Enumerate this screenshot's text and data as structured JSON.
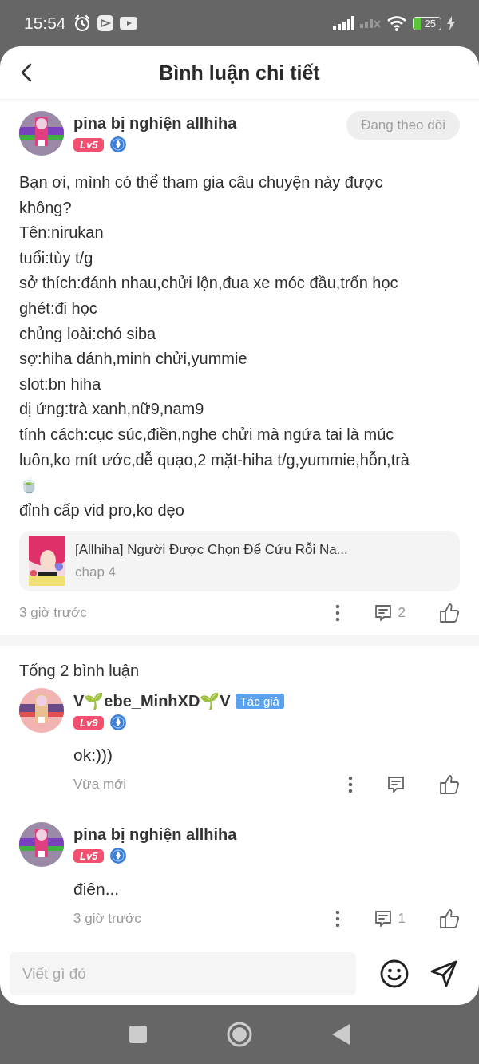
{
  "status_bar": {
    "time": "15:54",
    "battery": "25"
  },
  "header": {
    "title": "Bình luận chi tiết"
  },
  "post": {
    "author": "pina bị nghiện allhiha",
    "level": "Lv5",
    "follow_button": {
      "label": "Đang theo dõi",
      "disabled": true
    },
    "body": "Bạn ơi, mình có thể tham gia câu chuyện này được không?\nTên:nirukan\ntuổi:tùy t/g\nsở thích:đánh nhau,chửi lộn,đua xe móc đầu,trốn học\nghét:đi học\nchủng loài:chó siba\nsợ:hiha đánh,minh chửi,yummie\nslot:bn hiha\ndị ứng:trà xanh,nữ9,nam9\ntính cách:cục súc,điền,nghe chửi mà ngứa tai là múc luôn,ko mít ước,dễ quạo,2 mặt-hiha t/g,yummie,hỗn,trà🍵\nđỉnh cấp vid pro,ko dẹo",
    "story": {
      "title": "[Allhiha] Người Được Chọn Để Cứu Rỗi Na...",
      "chapter": "chap 4"
    },
    "time": "3 giờ trước",
    "reply_count": "2"
  },
  "comments_header": "Tổng 2 bình luận",
  "comments": [
    {
      "author": "V🌱ebe_MinhXD🌱V",
      "author_badge": "Tác giả",
      "level": "Lv9",
      "text": "ok:)))",
      "time": "Vừa mới"
    },
    {
      "author": "pina bị nghiện allhiha",
      "level": "Lv5",
      "text": "điên...",
      "time": "3 giờ trước",
      "reply_count": "1"
    }
  ],
  "input": {
    "placeholder": "Viết gì đó"
  }
}
